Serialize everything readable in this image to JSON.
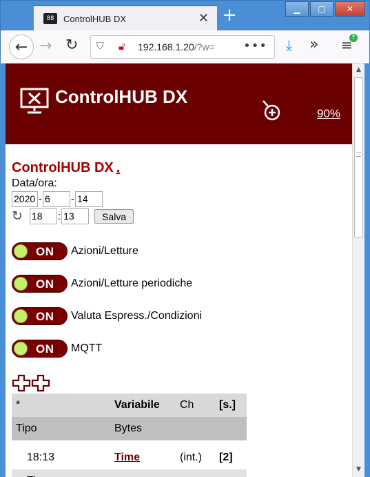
{
  "browser": {
    "tab_title": "ControlHUB DX",
    "tab_favicon_text": "88",
    "url_host": "192.168.1.20",
    "url_path": "/?w=",
    "url_more": "•••"
  },
  "header": {
    "title": "ControlHUB DX",
    "zoom_label": "90%"
  },
  "page": {
    "title": "ControlHUB DX",
    "title_link": ".",
    "datetime_label": "Data/ora:",
    "year": "2020",
    "month": "6",
    "day": "14",
    "date_sep": "-",
    "hour": "18",
    "minute": "13",
    "time_sep": ":",
    "save_button": "Salva"
  },
  "toggles": [
    {
      "state": "ON",
      "label": "Azioni/Letture"
    },
    {
      "state": "ON",
      "label": "Azioni/Letture periodiche"
    },
    {
      "state": "ON",
      "label": "Valuta Espress./Condizioni"
    },
    {
      "state": "ON",
      "label": "MQTT"
    }
  ],
  "table": {
    "header1": [
      "*",
      "Variabile",
      "Ch",
      "[s.]"
    ],
    "header2": [
      "Tipo",
      "Bytes"
    ],
    "rows": [
      {
        "col1": "18:13",
        "variable": "Time",
        "ch": "(int.)",
        "sec": "[2]"
      },
      {
        "col1": "Time"
      }
    ]
  },
  "colors": {
    "header_bg": "#6b0000",
    "title_red": "#a30000",
    "toggle_bg": "#7a0000",
    "toggle_knob": "#c8f06a",
    "table_header": "#d9d9d9",
    "table_subheader": "#bfbfbf"
  }
}
